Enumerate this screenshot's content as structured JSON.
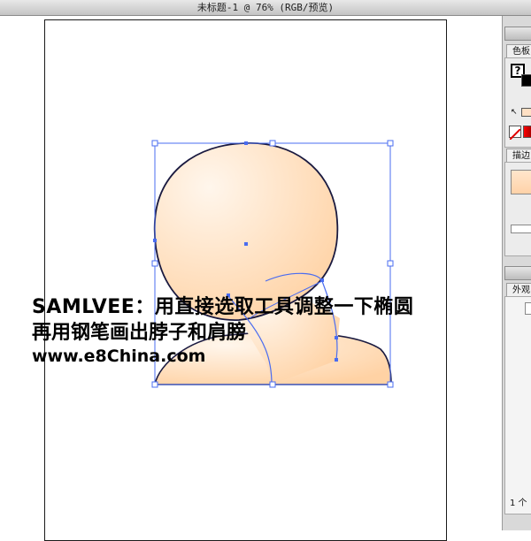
{
  "window": {
    "title": "未标题-1 @ 76% (RGB/预览)"
  },
  "panels": {
    "swatches_tab": "色板",
    "swatches_question": "?",
    "stroke_tab": "描边",
    "appearance_tab": "外观",
    "appearance_count": "1 个"
  },
  "caption": {
    "line1": "SAMLVEE：用直接选取工具调整一下椭圆",
    "line2": "再用钢笔画出脖子和肩膀",
    "line3": "www.e8China.com"
  },
  "colors": {
    "skin_light": "#fff6ec",
    "skin_dark": "#ffd4a8",
    "selection": "#4a6cf0",
    "outline": "#1a1a40"
  }
}
